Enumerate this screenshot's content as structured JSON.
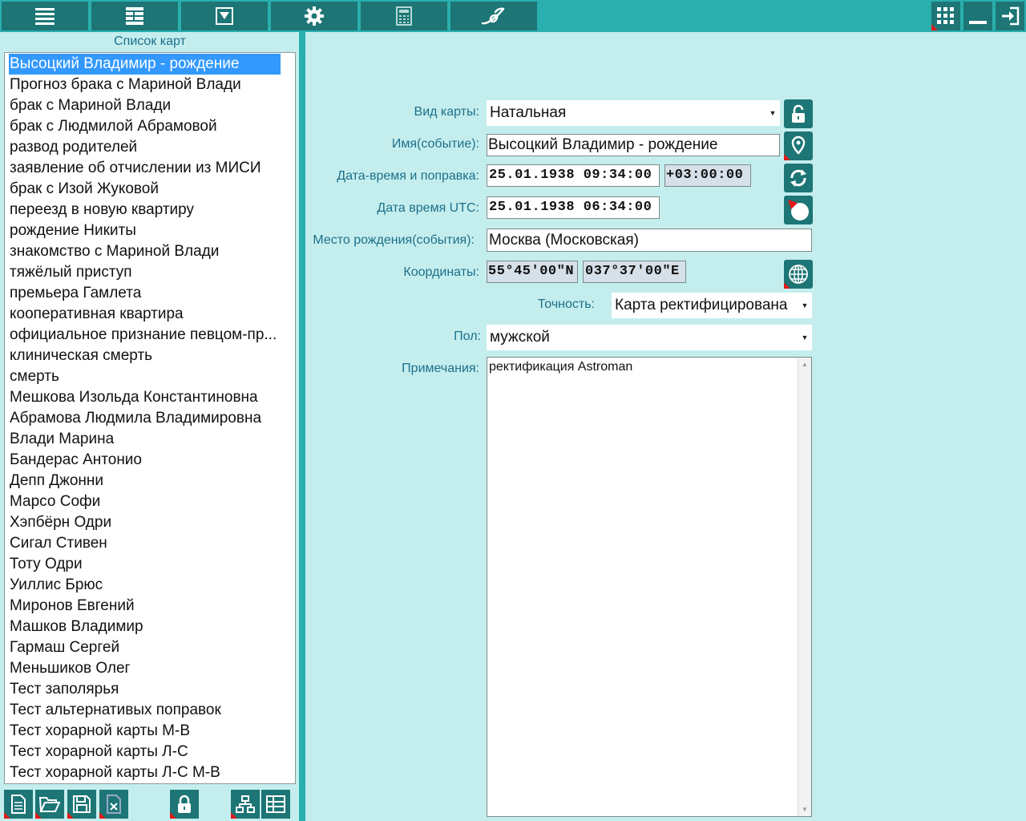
{
  "toolbar": {
    "icons": [
      "menu-icon",
      "list-icon",
      "dropdown-icon",
      "gear-icon",
      "calculator-icon",
      "logo-icon"
    ],
    "right_icons": [
      "grid-icon",
      "minimize-icon",
      "exit-icon"
    ]
  },
  "sidebar": {
    "title": "Список карт",
    "items": [
      "Высоцкий Владимир - рождение",
      "Прогноз брака с Мариной Влади",
      "брак с Мариной Влади",
      "брак с Людмилой Абрамовой",
      "развод родителей",
      "заявление об отчислении из МИСИ",
      "брак с Изой Жуковой",
      "переезд в новую квартиру",
      "рождение Никиты",
      "знакомство с Мариной Влади",
      "тяжёлый приступ",
      "премьера Гамлета",
      "кооперативная квартира",
      "официальное признание певцом-пр...",
      "клиническая смерть",
      "смерть",
      "Мешкова Изольда Константиновна",
      "Абрамова Людмила Владимировна",
      "Влади Марина",
      "Бандерас Антонио",
      "Депп Джонни",
      "Марсо Софи",
      "Хэпбёрн Одри",
      "Сигал Стивен",
      "Тоту Одри",
      "Уиллис Брюс",
      "Миронов Евгений",
      "Машков Владимир",
      "Гармаш Сергей",
      "Меньшиков Олег",
      "Тест заполярья",
      "Тест альтернативых поправок",
      "Тест хорарной карты М-В",
      "Тест хорарной карты Л-С",
      "Тест хорарной карты Л-С М-В"
    ],
    "selected_index": 0
  },
  "form": {
    "chart_type_label": "Вид карты:",
    "chart_type_value": "Натальная",
    "name_label": "Имя(событие):",
    "name_value": "Высоцкий Владимир - рождение",
    "datetime_label": "Дата-время и поправка:",
    "datetime_value": "25.01.1938 09:34:00",
    "offset_value": "+03:00:00",
    "utc_label": "Дата время UTC:",
    "utc_value": "25.01.1938 06:34:00",
    "place_label": "Место рождения(события):",
    "place_value": "Москва (Московская)",
    "coords_label": "Координаты:",
    "lat_value": "55°45'00\"N",
    "lon_value": "037°37'00\"E",
    "accuracy_label": "Точность:",
    "accuracy_value": "Карта ректифицирована",
    "gender_label": "Пол:",
    "gender_value": "мужской",
    "notes_label": "Примечания:",
    "notes_value": "ректификация Astroman"
  },
  "colors": {
    "background": "#c4eeee",
    "toolbar": "#2aaeae",
    "button": "#1d7575",
    "selection": "#3399ff",
    "label": "#1d6f8a"
  }
}
